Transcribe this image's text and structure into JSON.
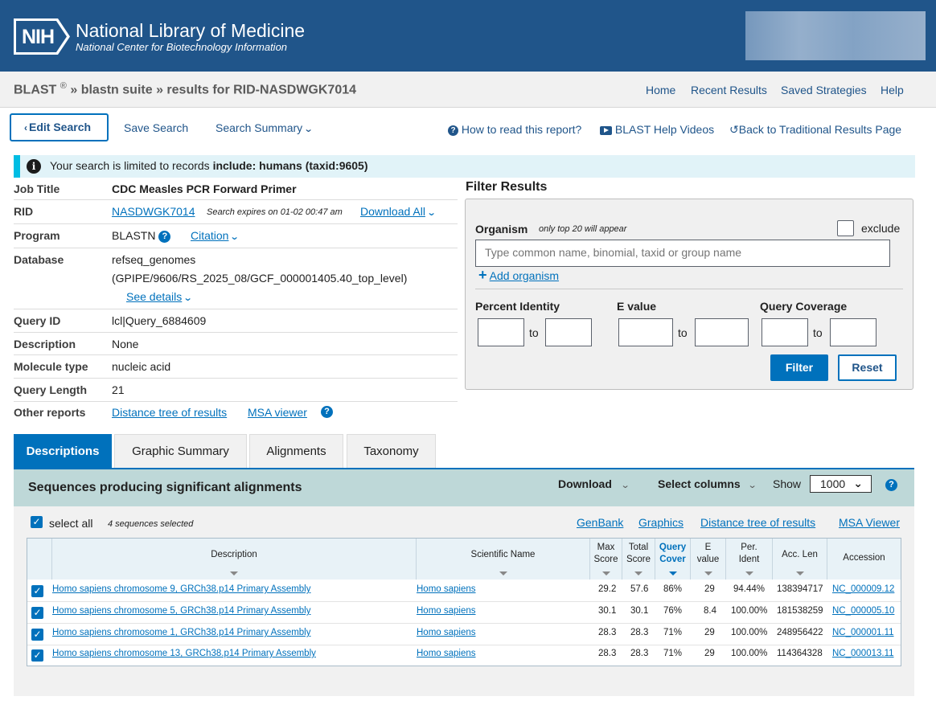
{
  "header": {
    "logo_text": "NIH",
    "title": "National Library of Medicine",
    "subtitle": "National Center for Biotechnology Information"
  },
  "breadcrumb": {
    "app": "BLAST",
    "reg": "®",
    "sep1": "»",
    "suite": "blastn suite",
    "sep2": "»",
    "results": "results for RID-NASDWGK7014"
  },
  "top_nav": [
    "Home",
    "Recent Results",
    "Saved Strategies",
    "Help"
  ],
  "actions": {
    "edit": "Edit Search",
    "save": "Save Search",
    "summary": "Search Summary",
    "how_to": "How to read this report?",
    "videos": "BLAST Help Videos",
    "back": "Back to Traditional Results Page"
  },
  "banner": {
    "prefix": "Your search is limited to records",
    "bold": "include: humans (taxid:9605)"
  },
  "job": {
    "title_label": "Job Title",
    "title_value": "CDC Measles PCR Forward Primer",
    "rid_label": "RID",
    "rid_value": "NASDWGK7014",
    "rid_expires": "Search expires on 01-02 00:47 am",
    "download_all": "Download All",
    "program_label": "Program",
    "program_value": "BLASTN",
    "citation": "Citation",
    "database_label": "Database",
    "database_line1": "refseq_genomes",
    "database_line2": "(GPIPE/9606/RS_2025_08/GCF_000001405.40_top_level)",
    "see_details": "See details",
    "query_id_label": "Query ID",
    "query_id_value": "lcl|Query_6884609",
    "description_label": "Description",
    "description_value": "None",
    "molecule_label": "Molecule type",
    "molecule_value": "nucleic acid",
    "query_length_label": "Query Length",
    "query_length_value": "21",
    "other_label": "Other reports",
    "other_distance": "Distance tree of results",
    "other_msa": "MSA viewer"
  },
  "filter": {
    "title": "Filter Results",
    "organism_label": "Organism",
    "organism_note": "only top 20 will appear",
    "exclude": "exclude",
    "organism_placeholder": "Type common  name, binomial, taxid or group  name",
    "add_organism": "Add organism",
    "percent_identity": "Percent Identity",
    "e_value": "E value",
    "query_coverage": "Query Coverage",
    "to": "to",
    "filter_btn": "Filter",
    "reset_btn": "Reset"
  },
  "tabs": [
    "Descriptions",
    "Graphic Summary",
    "Alignments",
    "Taxonomy"
  ],
  "results": {
    "title": "Sequences producing significant alignments",
    "download": "Download",
    "select_columns": "Select columns",
    "show_label": "Show",
    "show_value": "1000",
    "select_all": "select all",
    "selected_note": "4 sequences selected",
    "links": [
      "GenBank",
      "Graphics",
      "Distance tree of results",
      "MSA Viewer"
    ]
  },
  "table": {
    "headers": {
      "description": "Description",
      "scientific": "Scientific Name",
      "max1": "Max",
      "max2": "Score",
      "total1": "Total",
      "total2": "Score",
      "qc1": "Query",
      "qc2": "Cover",
      "e1": "E",
      "e2": "value",
      "per1": "Per.",
      "per2": "Ident",
      "acc_len": "Acc. Len",
      "accession": "Accession"
    },
    "rows": [
      {
        "description": "Homo sapiens chromosome 9, GRCh38.p14 Primary Assembly",
        "scientific": "Homo sapiens",
        "max": "29.2",
        "total": "57.6",
        "cover": "86%",
        "e": "29",
        "ident": "94.44%",
        "len": "138394717",
        "accession": "NC_000009.12"
      },
      {
        "description": "Homo sapiens chromosome 5, GRCh38.p14 Primary Assembly",
        "scientific": "Homo sapiens",
        "max": "30.1",
        "total": "30.1",
        "cover": "76%",
        "e": "8.4",
        "ident": "100.00%",
        "len": "181538259",
        "accession": "NC_000005.10"
      },
      {
        "description": "Homo sapiens chromosome 1, GRCh38.p14 Primary Assembly",
        "scientific": "Homo sapiens",
        "max": "28.3",
        "total": "28.3",
        "cover": "71%",
        "e": "29",
        "ident": "100.00%",
        "len": "248956422",
        "accession": "NC_000001.11"
      },
      {
        "description": "Homo sapiens chromosome 13, GRCh38.p14 Primary Assembly",
        "scientific": "Homo sapiens",
        "max": "28.3",
        "total": "28.3",
        "cover": "71%",
        "e": "29",
        "ident": "100.00%",
        "len": "114364328",
        "accession": "NC_000013.11"
      }
    ]
  },
  "colors": {
    "header_bg": "#20558a",
    "accent": "#0071bc",
    "results_head": "#bed8d8",
    "banner_bg": "#e1f3f8",
    "banner_border": "#00bde3"
  }
}
